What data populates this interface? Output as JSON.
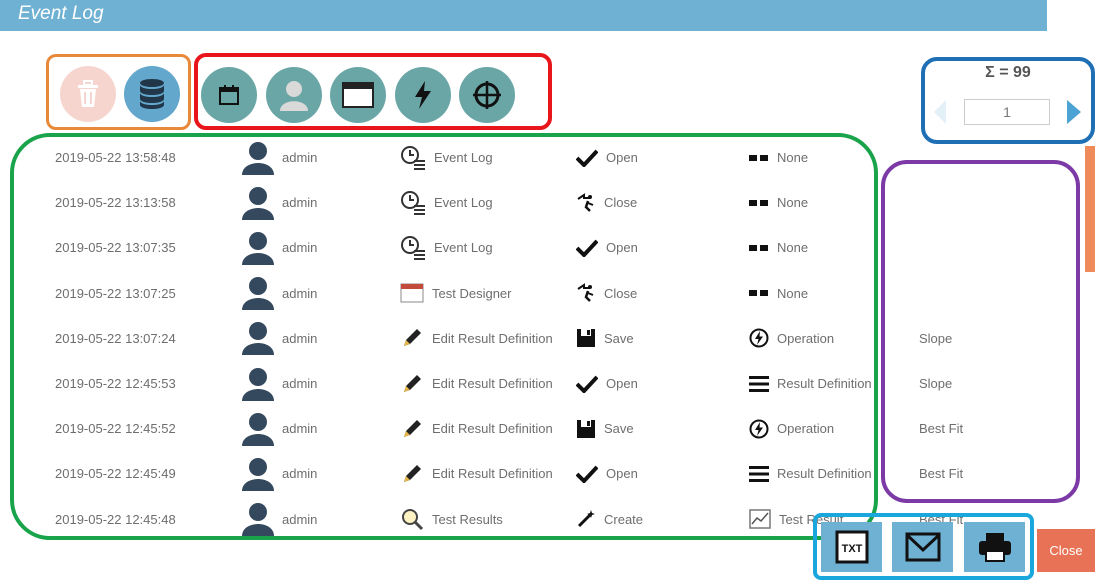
{
  "window": {
    "title": "Event Log"
  },
  "toolbar": {
    "left_icons": [
      "trash-icon",
      "database-icon"
    ],
    "filter_icons": [
      "calendar-icon",
      "user-icon",
      "window-icon",
      "lightning-icon",
      "crosshair-icon"
    ]
  },
  "pager": {
    "sum_label": "Σ = 99",
    "page_value": "1"
  },
  "events": [
    {
      "timestamp": "2019-05-22 13:58:48",
      "user": "admin",
      "module_icon": "clock-list-icon",
      "module": "Event Log",
      "action_icon": "check-icon",
      "action": "Open",
      "object_icon": "dash-icon",
      "object": "None",
      "detail": ""
    },
    {
      "timestamp": "2019-05-22 13:13:58",
      "user": "admin",
      "module_icon": "clock-list-icon",
      "module": "Event Log",
      "action_icon": "exit-icon",
      "action": "Close",
      "object_icon": "dash-icon",
      "object": "None",
      "detail": ""
    },
    {
      "timestamp": "2019-05-22 13:07:35",
      "user": "admin",
      "module_icon": "clock-list-icon",
      "module": "Event Log",
      "action_icon": "check-icon",
      "action": "Open",
      "object_icon": "dash-icon",
      "object": "None",
      "detail": ""
    },
    {
      "timestamp": "2019-05-22 13:07:25",
      "user": "admin",
      "module_icon": "designer-window-icon",
      "module": "Test Designer",
      "action_icon": "exit-icon",
      "action": "Close",
      "object_icon": "dash-icon",
      "object": "None",
      "detail": ""
    },
    {
      "timestamp": "2019-05-22 13:07:24",
      "user": "admin",
      "module_icon": "pencil-icon",
      "module": "Edit Result Definition",
      "action_icon": "save-icon",
      "action": "Save",
      "object_icon": "operation-icon",
      "object": "Operation",
      "detail": "Slope"
    },
    {
      "timestamp": "2019-05-22 12:45:53",
      "user": "admin",
      "module_icon": "pencil-icon",
      "module": "Edit Result Definition",
      "action_icon": "check-icon",
      "action": "Open",
      "object_icon": "lines-icon",
      "object": "Result Definition",
      "detail": "Slope"
    },
    {
      "timestamp": "2019-05-22 12:45:52",
      "user": "admin",
      "module_icon": "pencil-icon",
      "module": "Edit Result Definition",
      "action_icon": "save-icon",
      "action": "Save",
      "object_icon": "operation-icon",
      "object": "Operation",
      "detail": "Best Fit"
    },
    {
      "timestamp": "2019-05-22 12:45:49",
      "user": "admin",
      "module_icon": "pencil-icon",
      "module": "Edit Result Definition",
      "action_icon": "check-icon",
      "action": "Open",
      "object_icon": "lines-icon",
      "object": "Result Definition",
      "detail": "Best Fit"
    },
    {
      "timestamp": "2019-05-22 12:45:48",
      "user": "admin",
      "module_icon": "magnifier-icon",
      "module": "Test Results",
      "action_icon": "wand-icon",
      "action": "Create",
      "object_icon": "chart-icon",
      "object": "Test Result",
      "detail": "Best Fit"
    }
  ],
  "footer": {
    "export_icons": [
      "txt-icon",
      "mail-icon",
      "printer-icon"
    ],
    "txt_label": "TXT",
    "close_label": "Close"
  },
  "colors": {
    "title_bar": "#6fb1d3",
    "teal": "#6ba6a7",
    "close": "#e87255",
    "annotation_orange": "#e8893a",
    "annotation_red": "#e8161b",
    "annotation_blue": "#1f6fb5",
    "annotation_green": "#19a34a",
    "annotation_purple": "#7b3aa6",
    "annotation_cyan": "#1aa7de"
  }
}
